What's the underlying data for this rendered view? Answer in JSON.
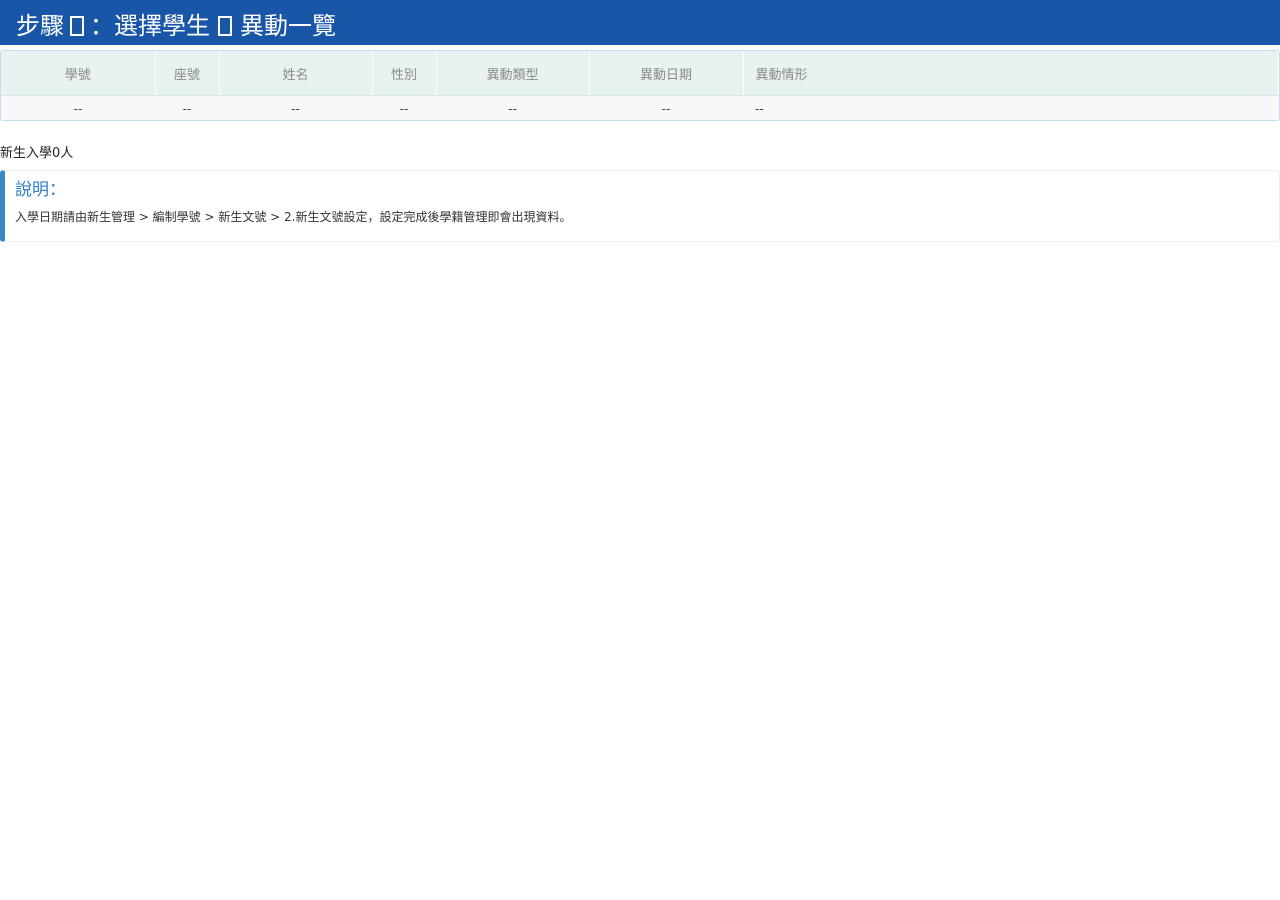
{
  "header": {
    "step_prefix": "步驟",
    "step_suffix": "：選擇學生",
    "page_title": "異動一覽"
  },
  "table": {
    "columns": [
      "學號",
      "座號",
      "姓名",
      "性別",
      "異動類型",
      "異動日期",
      "異動情形"
    ],
    "rows": [
      [
        "--",
        "--",
        "--",
        "--",
        "--",
        "--",
        "--"
      ]
    ]
  },
  "summary": {
    "count_text": "新生入學0人"
  },
  "note": {
    "title": "說明：",
    "text": "入學日期請由新生管理 > 編制學號 > 新生文號 > 2.新生文號設定，設定完成後學籍管理即會出現資料。"
  },
  "colors": {
    "banner": "#1a56a8",
    "table_header": "#e8f2f1",
    "accent": "#3a87c8"
  }
}
